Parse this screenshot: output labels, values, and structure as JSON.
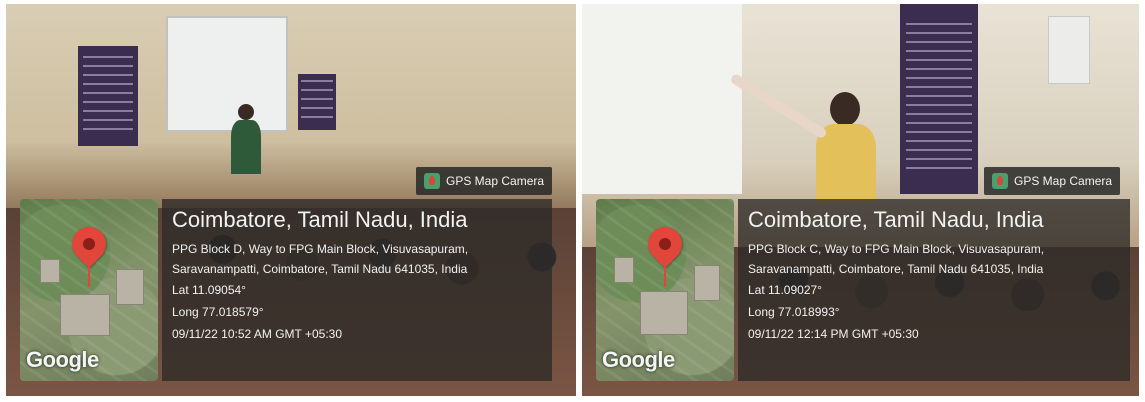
{
  "photos": [
    {
      "badge": "GPS Map Camera",
      "map_brand": "Google",
      "city": "Coimbatore, Tamil Nadu, India",
      "address_line1": "PPG Block D, Way to FPG Main Block, Visuvasapuram,",
      "address_line2": "Saravanampatti, Coimbatore, Tamil Nadu 641035, India",
      "lat": "Lat 11.09054°",
      "long": "Long 77.018579°",
      "datetime": "09/11/22 10:52 AM GMT +05:30"
    },
    {
      "badge": "GPS Map Camera",
      "map_brand": "Google",
      "city": "Coimbatore, Tamil Nadu, India",
      "address_line1": "PPG Block C, Way to FPG Main Block, Visuvasapuram,",
      "address_line2": "Saravanampatti, Coimbatore, Tamil Nadu 641035, India",
      "lat": "Lat 11.09027°",
      "long": "Long 77.018993°",
      "datetime": "09/11/22 12:14 PM GMT +05:30"
    }
  ]
}
